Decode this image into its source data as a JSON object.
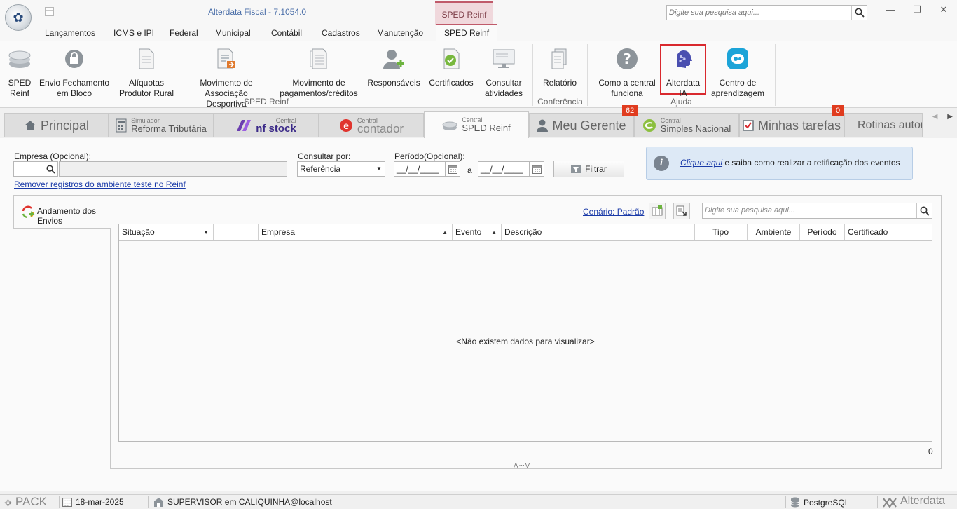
{
  "window": {
    "app_title": "Alterdata Fiscal - 7.1054.0",
    "context_tab_title": "SPED Reinf",
    "search_placeholder": "Digite sua pesquisa aqui...",
    "minimize": "—",
    "restore": "❐",
    "close": "✕"
  },
  "ribbon_tabs": [
    {
      "label": "Lançamentos"
    },
    {
      "label": "ICMS e IPI"
    },
    {
      "label": "Federal"
    },
    {
      "label": "Municipal"
    },
    {
      "label": "Contábil"
    },
    {
      "label": "Cadastros"
    },
    {
      "label": "Manutenção"
    },
    {
      "label": "SPED Reinf",
      "active": true
    }
  ],
  "ribbon": {
    "buttons": [
      {
        "line1": "SPED",
        "line2": "Reinf",
        "icon": "sped-reinf-icon"
      },
      {
        "line1": "Envio Fechamento",
        "line2": "em Bloco",
        "icon": "lock-icon"
      },
      {
        "line1": "Alíquotas",
        "line2": "Produtor Rural",
        "icon": "document-icon"
      },
      {
        "line1": "Movimento de",
        "line2": "Associação Desportiva",
        "icon": "list-document-icon"
      },
      {
        "line1": "Movimento de",
        "line2": "pagamentos/créditos",
        "icon": "payments-document-icon"
      },
      {
        "line1": "Responsáveis",
        "line2": "",
        "icon": "user-add-icon"
      },
      {
        "line1": "Certificados",
        "line2": "",
        "icon": "certificate-icon"
      },
      {
        "line1": "Consultar",
        "line2": "atividades",
        "icon": "monitor-icon"
      },
      {
        "line1": "Relatório",
        "line2": "",
        "icon": "report-icon"
      },
      {
        "line1": "Como a central",
        "line2": "funciona",
        "icon": "question-icon"
      },
      {
        "line1": "Alterdata",
        "line2": "IA",
        "icon": "ai-head-icon"
      },
      {
        "line1": "Centro de",
        "line2": "aprendizagem",
        "icon": "learning-icon"
      }
    ],
    "groups": [
      {
        "label": "SPED Reinf"
      },
      {
        "label": "Conferência"
      },
      {
        "label": "Ajuda"
      }
    ]
  },
  "module_tabs": {
    "principal": "Principal",
    "simulador_small": "Simulador",
    "simulador_main": "Reforma Tributária",
    "nfstock_small": "Central",
    "nfstock_main": "nf stock",
    "contador_small": "Central",
    "contador_main": "contador",
    "sped_small": "Central",
    "sped_main": "SPED Reinf",
    "gerente": "Meu Gerente",
    "gerente_badge": "62",
    "simples_small": "Central",
    "simples_main": "Simples Nacional",
    "tarefas": "Minhas tarefas",
    "tarefas_badge": "0",
    "rotinas": "Rotinas automa"
  },
  "filters": {
    "empresa_label": "Empresa (Opcional):",
    "empresa_code": "",
    "empresa_name": "",
    "remove_link": "Remover registros do ambiente teste no Reinf",
    "consultar_label": "Consultar por:",
    "consultar_value": "Referência",
    "periodo_label": "Período(Opcional):",
    "periodo_start": "__/__/____",
    "periodo_sep": "a",
    "periodo_end": "__/__/____",
    "filtrar_button": "Filtrar"
  },
  "info": {
    "link_text": "Clique aqui",
    "text": " e saiba como realizar a retificação dos eventos"
  },
  "panel": {
    "side_tab": "Andamento dos Envios",
    "cenario_link": "Cenário: Padrão",
    "search_placeholder": "Digite sua pesquisa aqui...",
    "columns": [
      {
        "label": "Situação"
      },
      {
        "label": ""
      },
      {
        "label": "Empresa"
      },
      {
        "label": "Evento"
      },
      {
        "label": "Descrição"
      },
      {
        "label": "Tipo"
      },
      {
        "label": "Ambiente"
      },
      {
        "label": "Período"
      },
      {
        "label": "Certificado"
      }
    ],
    "empty_message": "<Não existem dados para visualizar>",
    "record_count": "0"
  },
  "statusbar": {
    "pack": "PACK",
    "date": "18-mar-2025",
    "user": "SUPERVISOR em CALIQUINHA@localhost",
    "db": "PostgreSQL",
    "brand": "Alterdata"
  },
  "colors": {
    "accent_context": "#c05a6a",
    "highlight_box": "#d9292e",
    "badge": "#e03c1f",
    "link": "#1a3aa8"
  }
}
